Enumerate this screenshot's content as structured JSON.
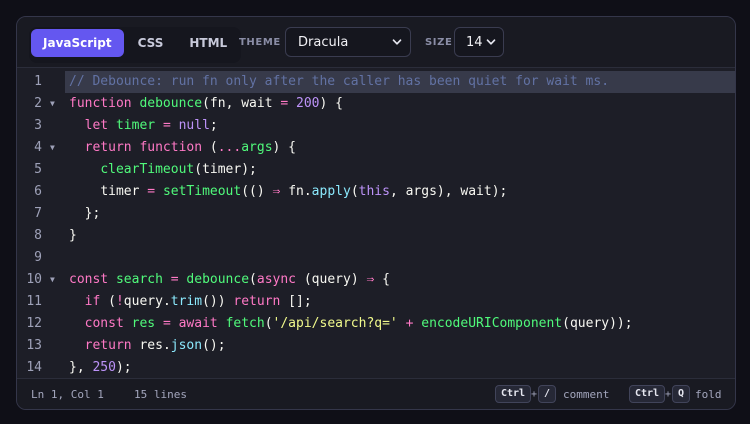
{
  "tabs": [
    {
      "label": "JavaScript",
      "active": true
    },
    {
      "label": "CSS",
      "active": false
    },
    {
      "label": "HTML",
      "active": false
    }
  ],
  "theme": {
    "label": "THEME",
    "value": "Dracula"
  },
  "size": {
    "label": "SIZE",
    "value": "14"
  },
  "lines": [
    {
      "num": "1",
      "fold": "",
      "current": true,
      "tokens": [
        {
          "t": "// Debounce: run fn only after the caller has been quiet for wait ms.",
          "c": "cm"
        }
      ]
    },
    {
      "num": "2",
      "fold": "▼",
      "tokens": [
        {
          "t": "function",
          "c": "kw"
        },
        {
          "t": " ",
          "c": "pl"
        },
        {
          "t": "debounce",
          "c": "fn"
        },
        {
          "t": "(",
          "c": "pl"
        },
        {
          "t": "fn",
          "c": "var"
        },
        {
          "t": ", ",
          "c": "pl"
        },
        {
          "t": "wait",
          "c": "var"
        },
        {
          "t": " ",
          "c": "pl"
        },
        {
          "t": "=",
          "c": "op"
        },
        {
          "t": " ",
          "c": "pl"
        },
        {
          "t": "200",
          "c": "num"
        },
        {
          "t": ") {",
          "c": "pl"
        }
      ]
    },
    {
      "num": "3",
      "fold": "",
      "tokens": [
        {
          "t": "  ",
          "c": "pl"
        },
        {
          "t": "let",
          "c": "kw"
        },
        {
          "t": " ",
          "c": "pl"
        },
        {
          "t": "timer",
          "c": "fn"
        },
        {
          "t": " ",
          "c": "pl"
        },
        {
          "t": "=",
          "c": "op"
        },
        {
          "t": " ",
          "c": "pl"
        },
        {
          "t": "null",
          "c": "num"
        },
        {
          "t": ";",
          "c": "pl"
        }
      ]
    },
    {
      "num": "4",
      "fold": "▼",
      "tokens": [
        {
          "t": "  ",
          "c": "pl"
        },
        {
          "t": "return",
          "c": "kw"
        },
        {
          "t": " ",
          "c": "pl"
        },
        {
          "t": "function",
          "c": "kw"
        },
        {
          "t": " (",
          "c": "pl"
        },
        {
          "t": "...",
          "c": "op"
        },
        {
          "t": "args",
          "c": "fn"
        },
        {
          "t": ") {",
          "c": "pl"
        }
      ]
    },
    {
      "num": "5",
      "fold": "",
      "tokens": [
        {
          "t": "    ",
          "c": "pl"
        },
        {
          "t": "clearTimeout",
          "c": "fn"
        },
        {
          "t": "(",
          "c": "pl"
        },
        {
          "t": "timer",
          "c": "var"
        },
        {
          "t": ");",
          "c": "pl"
        }
      ]
    },
    {
      "num": "6",
      "fold": "",
      "tokens": [
        {
          "t": "    ",
          "c": "pl"
        },
        {
          "t": "timer",
          "c": "var"
        },
        {
          "t": " ",
          "c": "pl"
        },
        {
          "t": "=",
          "c": "op"
        },
        {
          "t": " ",
          "c": "pl"
        },
        {
          "t": "setTimeout",
          "c": "fn"
        },
        {
          "t": "(() ",
          "c": "pl"
        },
        {
          "t": "⇒",
          "c": "op"
        },
        {
          "t": " ",
          "c": "pl"
        },
        {
          "t": "fn",
          "c": "var"
        },
        {
          "t": ".",
          "c": "pl"
        },
        {
          "t": "apply",
          "c": "mth"
        },
        {
          "t": "(",
          "c": "pl"
        },
        {
          "t": "this",
          "c": "ctx"
        },
        {
          "t": ", ",
          "c": "pl"
        },
        {
          "t": "args",
          "c": "var"
        },
        {
          "t": "), ",
          "c": "pl"
        },
        {
          "t": "wait",
          "c": "var"
        },
        {
          "t": ");",
          "c": "pl"
        }
      ]
    },
    {
      "num": "7",
      "fold": "",
      "tokens": [
        {
          "t": "  };",
          "c": "pl"
        }
      ]
    },
    {
      "num": "8",
      "fold": "",
      "tokens": [
        {
          "t": "}",
          "c": "pl"
        }
      ]
    },
    {
      "num": "9",
      "fold": "",
      "tokens": []
    },
    {
      "num": "10",
      "fold": "▼",
      "tokens": [
        {
          "t": "const",
          "c": "kw"
        },
        {
          "t": " ",
          "c": "pl"
        },
        {
          "t": "search",
          "c": "fn"
        },
        {
          "t": " ",
          "c": "pl"
        },
        {
          "t": "=",
          "c": "op"
        },
        {
          "t": " ",
          "c": "pl"
        },
        {
          "t": "debounce",
          "c": "fn"
        },
        {
          "t": "(",
          "c": "pl"
        },
        {
          "t": "async",
          "c": "kw"
        },
        {
          "t": " (",
          "c": "pl"
        },
        {
          "t": "query",
          "c": "var"
        },
        {
          "t": ") ",
          "c": "pl"
        },
        {
          "t": "⇒",
          "c": "op"
        },
        {
          "t": " {",
          "c": "pl"
        }
      ]
    },
    {
      "num": "11",
      "fold": "",
      "tokens": [
        {
          "t": "  ",
          "c": "pl"
        },
        {
          "t": "if",
          "c": "kw"
        },
        {
          "t": " (",
          "c": "pl"
        },
        {
          "t": "!",
          "c": "op"
        },
        {
          "t": "query",
          "c": "var"
        },
        {
          "t": ".",
          "c": "pl"
        },
        {
          "t": "trim",
          "c": "mth"
        },
        {
          "t": "()) ",
          "c": "pl"
        },
        {
          "t": "return",
          "c": "kw"
        },
        {
          "t": " [];",
          "c": "pl"
        }
      ]
    },
    {
      "num": "12",
      "fold": "",
      "tokens": [
        {
          "t": "  ",
          "c": "pl"
        },
        {
          "t": "const",
          "c": "kw"
        },
        {
          "t": " ",
          "c": "pl"
        },
        {
          "t": "res",
          "c": "fn"
        },
        {
          "t": " ",
          "c": "pl"
        },
        {
          "t": "=",
          "c": "op"
        },
        {
          "t": " ",
          "c": "pl"
        },
        {
          "t": "await",
          "c": "kw"
        },
        {
          "t": " ",
          "c": "pl"
        },
        {
          "t": "fetch",
          "c": "fn"
        },
        {
          "t": "(",
          "c": "pl"
        },
        {
          "t": "'/api/search?q='",
          "c": "str"
        },
        {
          "t": " ",
          "c": "pl"
        },
        {
          "t": "+",
          "c": "op"
        },
        {
          "t": " ",
          "c": "pl"
        },
        {
          "t": "encodeURIComponent",
          "c": "fn"
        },
        {
          "t": "(",
          "c": "pl"
        },
        {
          "t": "query",
          "c": "var"
        },
        {
          "t": "));",
          "c": "pl"
        }
      ]
    },
    {
      "num": "13",
      "fold": "",
      "tokens": [
        {
          "t": "  ",
          "c": "pl"
        },
        {
          "t": "return",
          "c": "kw"
        },
        {
          "t": " ",
          "c": "pl"
        },
        {
          "t": "res",
          "c": "var"
        },
        {
          "t": ".",
          "c": "pl"
        },
        {
          "t": "json",
          "c": "mth"
        },
        {
          "t": "();",
          "c": "pl"
        }
      ]
    },
    {
      "num": "14",
      "fold": "",
      "tokens": [
        {
          "t": "}, ",
          "c": "pl"
        },
        {
          "t": "250",
          "c": "num"
        },
        {
          "t": ");",
          "c": "pl"
        }
      ]
    }
  ],
  "status": {
    "position": "Ln 1, Col 1",
    "lines": "15 lines",
    "shortcut1": {
      "key1": "Ctrl",
      "plus": "+",
      "key2": "/",
      "label": "comment"
    },
    "shortcut2": {
      "key1": "Ctrl",
      "plus": "+",
      "key2": "Q",
      "label": "fold"
    }
  }
}
